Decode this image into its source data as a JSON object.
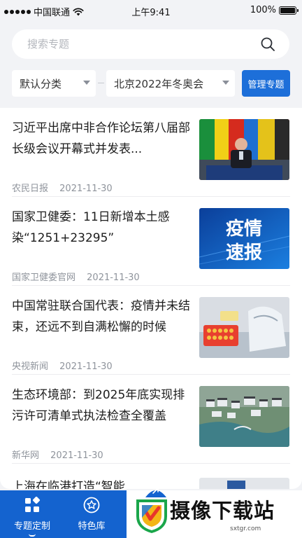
{
  "status_bar": {
    "carrier": "中国联通",
    "time": "上午9:41",
    "battery": "100%"
  },
  "search": {
    "placeholder": "搜索专题",
    "value": ""
  },
  "filters": {
    "category": "默认分类",
    "topic": "北京2022年冬奥会",
    "manage_label": "管理专题"
  },
  "news": [
    {
      "title": "习近平出席中非合作论坛第八届部长级会议开幕式并发表...",
      "source": "农民日报",
      "date": "2021-11-30",
      "thumb": "summit-photo"
    },
    {
      "title": "国家卫健委：11日新增本土感染“1251+23295”",
      "source": "国家卫健委官网",
      "date": "2021-11-30",
      "thumb": "epidemic-report-graphic",
      "thumb_text_1": "疫情",
      "thumb_text_2": "速报"
    },
    {
      "title": "中国常驻联合国代表：疫情并未结束，还远不到自满松懈的时候",
      "source": "央视新闻",
      "date": "2021-11-30",
      "thumb": "lab-test-photo"
    },
    {
      "title": "生态环境部：到2025年底实现排污许可清单式执法检查全覆盖",
      "source": "新华网",
      "date": "2021-11-30",
      "thumb": "aerial-town-photo"
    },
    {
      "title": "上海在临港打造“智能",
      "thumb": "partial-photo"
    }
  ],
  "tabs": [
    {
      "label": "专题定制",
      "icon": "grid-icon",
      "active": true
    },
    {
      "label": "特色库",
      "icon": "star-circle-icon",
      "active": false
    }
  ],
  "watermark": {
    "text": "摄像下载站",
    "url": "sxtgr.com"
  },
  "colors": {
    "accent": "#1d6fd9",
    "tab_bar": "#1463cf",
    "background": "#f2f3f6"
  }
}
